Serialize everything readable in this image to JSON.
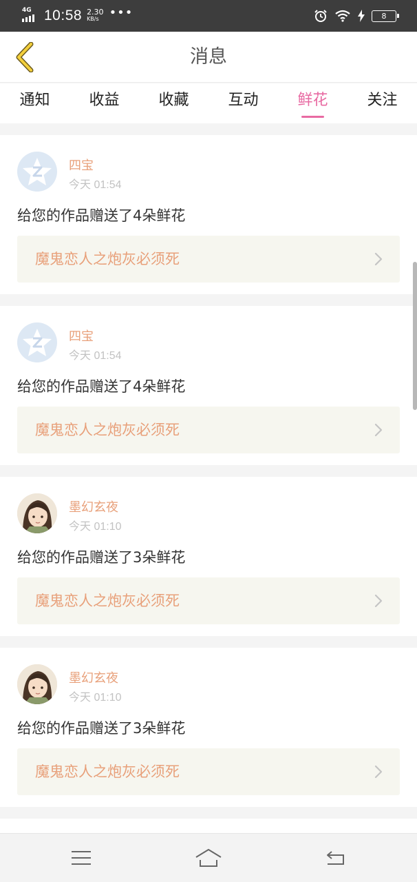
{
  "status_bar": {
    "network": "4G",
    "time": "10:58",
    "speed_value": "2.30",
    "speed_unit": "KB/s",
    "more": "•••",
    "battery": "8",
    "icons": [
      "signal-icon",
      "alarm-icon",
      "wifi-icon",
      "charging-icon",
      "battery-icon"
    ]
  },
  "header": {
    "title": "消息",
    "back_icon": "chevron-left-icon"
  },
  "tabs": [
    {
      "label": "通知",
      "active": false
    },
    {
      "label": "收益",
      "active": false
    },
    {
      "label": "收藏",
      "active": false
    },
    {
      "label": "互动",
      "active": false
    },
    {
      "label": "鲜花",
      "active": true
    },
    {
      "label": "关注",
      "active": false
    }
  ],
  "messages": [
    {
      "user": "四宝",
      "time": "今天 01:54",
      "text": "给您的作品赠送了4朵鲜花",
      "work": "魔鬼恋人之炮灰必须死",
      "avatar": "default-avatar-icon"
    },
    {
      "user": "四宝",
      "time": "今天 01:54",
      "text": "给您的作品赠送了4朵鲜花",
      "work": "魔鬼恋人之炮灰必须死",
      "avatar": "default-avatar-icon"
    },
    {
      "user": "墨幻玄夜",
      "time": "今天 01:10",
      "text": "给您的作品赠送了3朵鲜花",
      "work": "魔鬼恋人之炮灰必须死",
      "avatar": "user-photo-avatar"
    },
    {
      "user": "墨幻玄夜",
      "time": "今天 01:10",
      "text": "给您的作品赠送了3朵鲜花",
      "work": "魔鬼恋人之炮灰必须死",
      "avatar": "user-photo-avatar"
    }
  ],
  "nav_bar": {
    "icons": [
      "menu-icon",
      "home-icon",
      "back-icon"
    ]
  },
  "colors": {
    "accent_pink": "#e86aa2",
    "name_orange": "#e8a07a",
    "back_yellow": "#f3cf3c",
    "status_bar_bg": "#3d3d3d"
  }
}
